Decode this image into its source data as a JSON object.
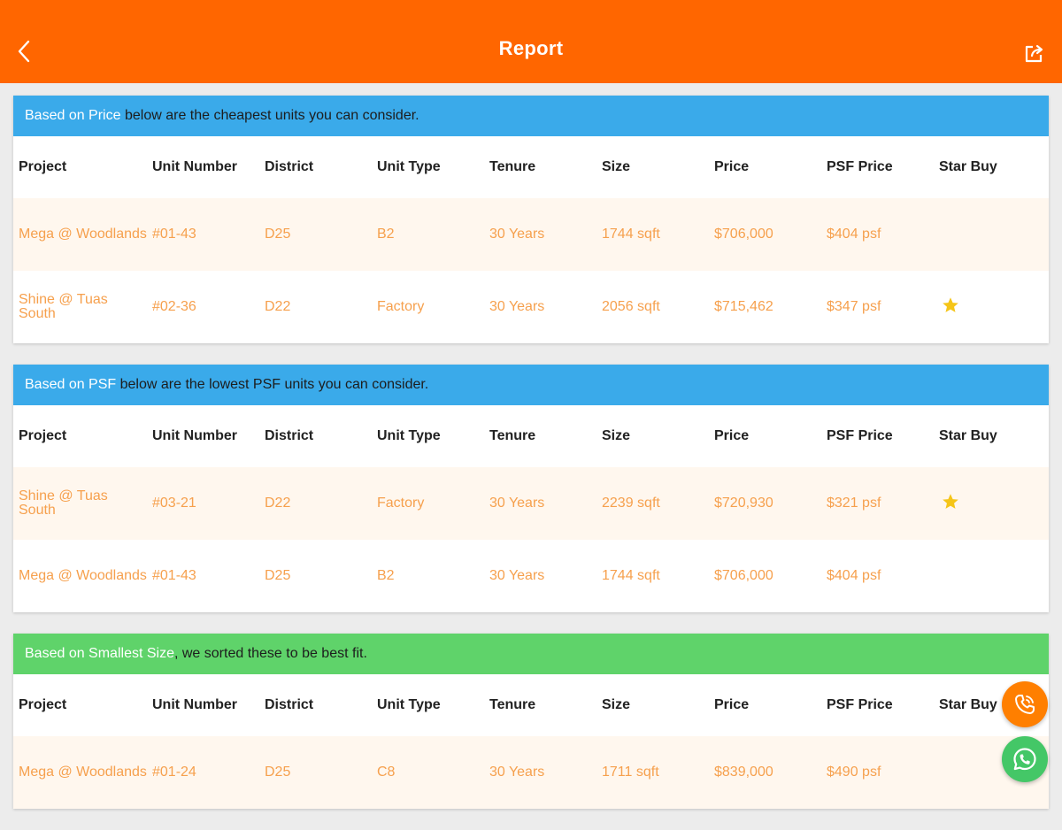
{
  "colors": {
    "appbar": "#ff6600",
    "price_section": "#3aaaea",
    "psf_section": "#3aaaea",
    "size_section": "#5fd36a",
    "data_text": "#f6a04d",
    "star": "#f5c518"
  },
  "appbar": {
    "title": "Report",
    "back_icon": "chevron-left-icon",
    "share_icon": "share-icon"
  },
  "columns": [
    "Project",
    "Unit Number",
    "District",
    "Unit Type",
    "Tenure",
    "Size",
    "Price",
    "PSF Price",
    "Star Buy"
  ],
  "sections": [
    {
      "highlight": "Based on Price",
      "rest": " below are the cheapest units you can consider.",
      "color": "#3aaaea",
      "rows": [
        {
          "project": "Mega @ Woodlands",
          "unit": "#01-43",
          "district": "D25",
          "type": "B2",
          "tenure": "30 Years",
          "size": "1744 sqft",
          "price": "$706,000",
          "psf": "$404 psf",
          "star": false
        },
        {
          "project": "Shine @ Tuas South",
          "unit": "#02-36",
          "district": "D22",
          "type": "Factory",
          "tenure": "30 Years",
          "size": "2056 sqft",
          "price": "$715,462",
          "psf": "$347 psf",
          "star": true
        }
      ]
    },
    {
      "highlight": "Based on PSF",
      "rest": " below are the lowest PSF units you can consider.",
      "color": "#3aaaea",
      "rows": [
        {
          "project": "Shine @ Tuas South",
          "unit": "#03-21",
          "district": "D22",
          "type": "Factory",
          "tenure": "30 Years",
          "size": "2239 sqft",
          "price": "$720,930",
          "psf": "$321 psf",
          "star": true
        },
        {
          "project": "Mega @ Woodlands",
          "unit": "#01-43",
          "district": "D25",
          "type": "B2",
          "tenure": "30 Years",
          "size": "1744 sqft",
          "price": "$706,000",
          "psf": "$404 psf",
          "star": false
        }
      ]
    },
    {
      "highlight": "Based on Smallest Size",
      "rest": ", we sorted these to be best fit.",
      "color": "#5fd36a",
      "rows": [
        {
          "project": "Mega @ Woodlands",
          "unit": "#01-24",
          "district": "D25",
          "type": "C8",
          "tenure": "30 Years",
          "size": "1711 sqft",
          "price": "$839,000",
          "psf": "$490 psf",
          "star": false
        }
      ]
    }
  ],
  "fabs": {
    "call_icon": "phone-icon",
    "whatsapp_icon": "whatsapp-icon"
  }
}
